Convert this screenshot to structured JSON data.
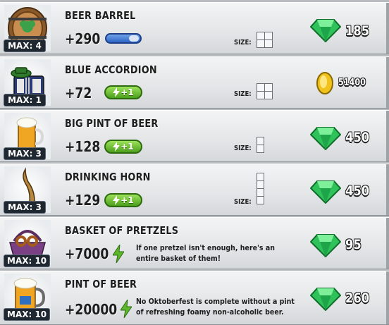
{
  "items": [
    {
      "title": "BEER BARREL",
      "max": "MAX: 4",
      "value": "+290",
      "size_label": "SIZE:",
      "price": "185",
      "currency": "gem-icon",
      "extra": "progress",
      "progress": 0.75
    },
    {
      "title": "BLUE ACCORDION",
      "max": "MAX: 1",
      "value": "+72",
      "energy": "+1",
      "size_label": "SIZE:",
      "price": "51400",
      "currency": "coin-icon"
    },
    {
      "title": "BIG PINT OF BEER",
      "max": "MAX: 3",
      "value": "+128",
      "energy": "+1",
      "size_label": "SIZE:",
      "price": "450",
      "currency": "gem-icon"
    },
    {
      "title": "DRINKING HORN",
      "max": "MAX: 3",
      "value": "+129",
      "energy": "+1",
      "size_label": "SIZE:",
      "price": "450",
      "currency": "gem-icon"
    },
    {
      "title": "BASKET OF PRETZELS",
      "max": "MAX: 10",
      "value": "+7000",
      "description": "If one pretzel isn't enough, here's an entire basket of them!",
      "price": "95",
      "currency": "gem-icon"
    },
    {
      "title": "PINT OF BEER",
      "max": "MAX: 10",
      "value": "+20000",
      "description": "No Oktoberfest is complete without a pint of refreshing foamy non-alcoholic beer.",
      "price": "260",
      "currency": "gem-icon"
    }
  ],
  "colors": {
    "gem": "#2fc25a",
    "coin": "#f1c21b",
    "energy": "#5cb82a",
    "badge": "#1f2731"
  }
}
